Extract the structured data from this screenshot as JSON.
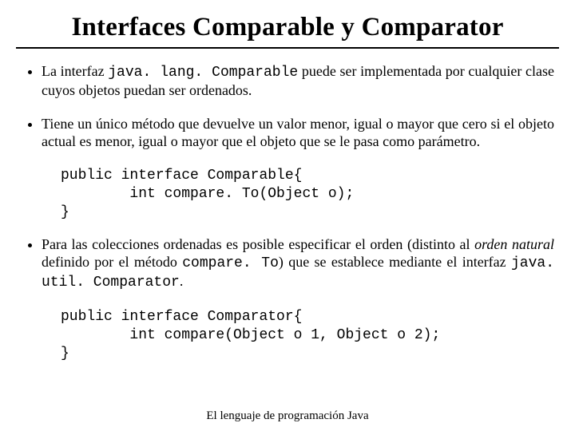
{
  "title": "Interfaces Comparable y Comparator",
  "bullets": {
    "b1_pre": "La interfaz ",
    "b1_code": "java. lang. Comparable",
    "b1_post": " puede ser implementada por cualquier clase cuyos objetos puedan ser ordenados.",
    "b2": "Tiene un único método que devuelve un valor menor, igual o mayor que cero si el objeto actual es menor, igual o mayor que el objeto que se le pasa como parámetro.",
    "b3_pre": "Para las colecciones ordenadas es posible especificar el orden (distinto al ",
    "b3_em": "orden natural",
    "b3_mid": " definido por el método ",
    "b3_code1": "compare. To",
    "b3_mid2": ") que se establece mediante el interfaz ",
    "b3_code2": "java. util. Comparator",
    "b3_post": "."
  },
  "code1": "public interface Comparable{\n        int compare. To(Object o);\n}",
  "code2": "public interface Comparator{\n        int compare(Object o 1, Object o 2);\n}",
  "footer": "El lenguaje de programación Java"
}
